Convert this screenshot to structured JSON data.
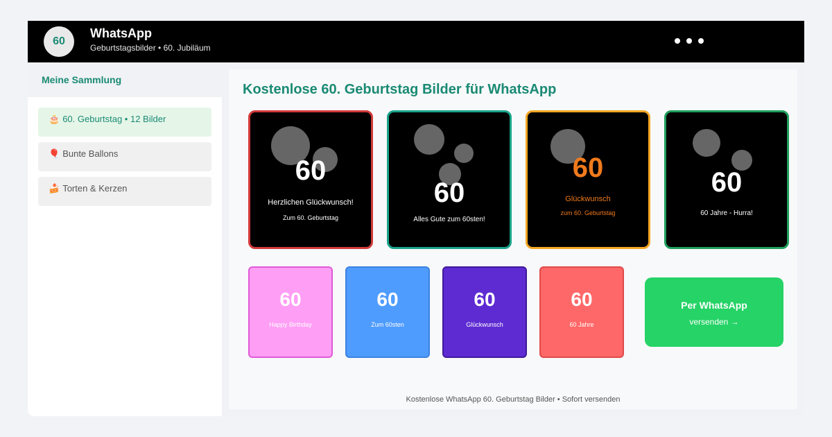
{
  "header": {
    "avatar_text": "60",
    "title": "WhatsApp",
    "subtitle": "Geburtstagsbilder • 60. Jubiläum",
    "menu_icon": "more-dots-icon"
  },
  "sidebar": {
    "heading": "Meine Sammlung",
    "items": [
      {
        "icon": "🎂",
        "label": "60. Geburtstag • 12 Bilder",
        "active": true
      },
      {
        "icon": "🎈",
        "label": "Bunte Ballons",
        "active": false
      },
      {
        "icon": "🍰",
        "label": "Torten & Kerzen",
        "active": false
      }
    ]
  },
  "main": {
    "title": "Kostenlose 60. Geburtstag Bilder für WhatsApp",
    "cards": [
      {
        "number": "60",
        "line1": "Herzlichen Glückwunsch!",
        "line2": "Zum 60. Geburtstag",
        "border": "#d23a3a",
        "text_color": "#ffffff"
      },
      {
        "number": "60",
        "line1": "Alles Gute zum 60sten!",
        "line2": "",
        "border": "#1aa38a",
        "text_color": "#ffffff"
      },
      {
        "number": "60",
        "line1": "Glückwunsch",
        "line2": "zum 60. Geburtstag",
        "border": "#f5a623",
        "text_color": "#f07a1c"
      },
      {
        "number": "60",
        "line1": "60 Jahre - Hurra!",
        "line2": "",
        "border": "#1f9e5c",
        "text_color": "#ffffff"
      }
    ],
    "tiles": [
      {
        "number": "60",
        "label": "Happy Birthday",
        "bg": "#ff9ef5",
        "border": "#e05ad8"
      },
      {
        "number": "60",
        "label": "Zum 60sten",
        "bg": "#4f9cff",
        "border": "#3a82e0"
      },
      {
        "number": "60",
        "label": "Glückwunsch",
        "bg": "#5e2bd3",
        "border": "#3e1a9a"
      },
      {
        "number": "60",
        "label": "60 Jahre",
        "bg": "#ff6868",
        "border": "#e04a4a"
      }
    ],
    "send_button": {
      "title": "Per WhatsApp",
      "subtitle": "versenden →"
    },
    "footer": "Kostenlose WhatsApp 60. Geburtstag Bilder • Sofort versenden"
  },
  "colors": {
    "accent": "#1a8a74",
    "whatsapp_green": "#25d366",
    "topbar": "#000000"
  }
}
